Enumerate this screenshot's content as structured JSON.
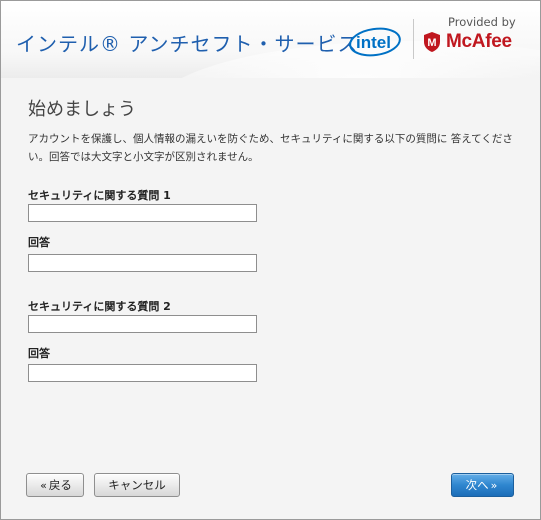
{
  "header": {
    "app_title": "インテル® アンチセフト・サービス",
    "intel_logo_text": "intel",
    "provided_by": "Provided by",
    "mcafee_text": "McAfee",
    "mcafee_shield_letter": "M"
  },
  "page": {
    "title": "始めましょう",
    "intro": "アカウントを保護し、個人情報の漏えいを防ぐため、セキュリティに関する以下の質問に 答えてください。回答では大文字と小文字が区別されません。"
  },
  "form": {
    "q1_label": "セキュリティに関する質問 1",
    "q1_value": "",
    "a1_label": "回答",
    "a1_value": "",
    "q2_label": "セキュリティに関する質問 2",
    "q2_value": "",
    "a2_label": "回答",
    "a2_value": ""
  },
  "buttons": {
    "back_icon": "«",
    "back_label": "戻る",
    "cancel_label": "キャンセル",
    "next_label": "次へ",
    "next_icon": "»"
  },
  "colors": {
    "title_blue": "#1f5fae",
    "intel_blue": "#0071c5",
    "mcafee_red": "#c0171f",
    "primary_button": "#2f86cf"
  }
}
